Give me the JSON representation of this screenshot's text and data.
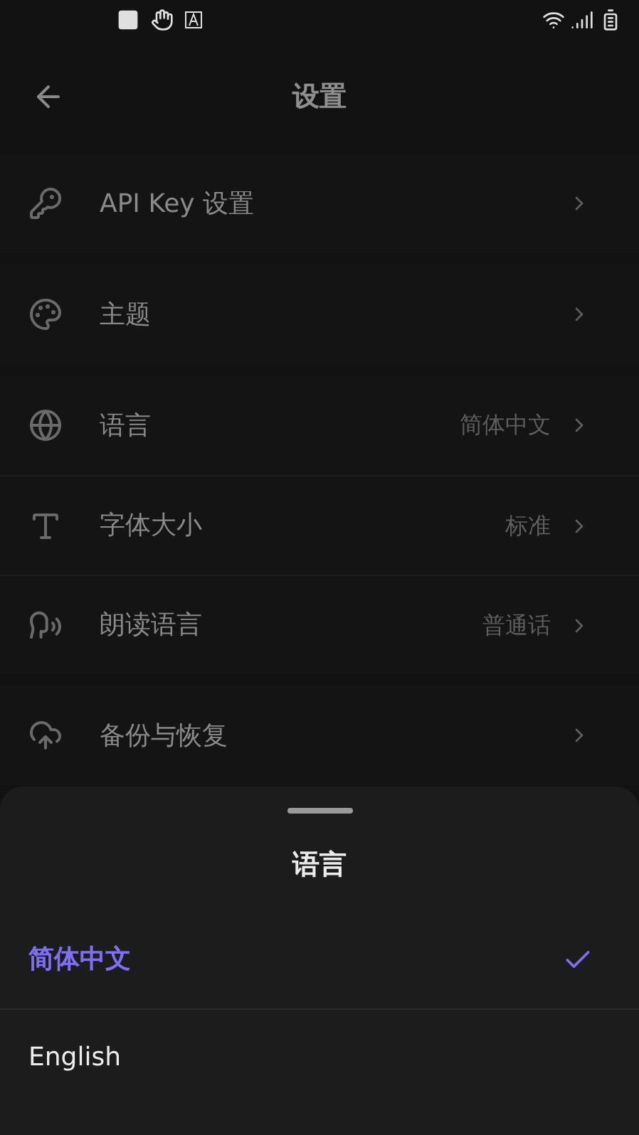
{
  "header": {
    "title": "设置"
  },
  "groups": [
    [
      {
        "kind": "key",
        "label": "API Key 设置"
      }
    ],
    [
      {
        "kind": "palette",
        "label": "主题"
      }
    ],
    [
      {
        "kind": "globe",
        "label": "语言",
        "value": "简体中文"
      },
      {
        "kind": "textsize",
        "label": "字体大小",
        "value": "标准"
      },
      {
        "kind": "speech",
        "label": "朗读语言",
        "value": "普通话"
      }
    ],
    [
      {
        "kind": "upload",
        "label": "备份与恢复"
      }
    ]
  ],
  "sheet": {
    "title": "语言",
    "options": [
      {
        "label": "简体中文",
        "selected": true
      },
      {
        "label": "English",
        "selected": false
      }
    ]
  }
}
